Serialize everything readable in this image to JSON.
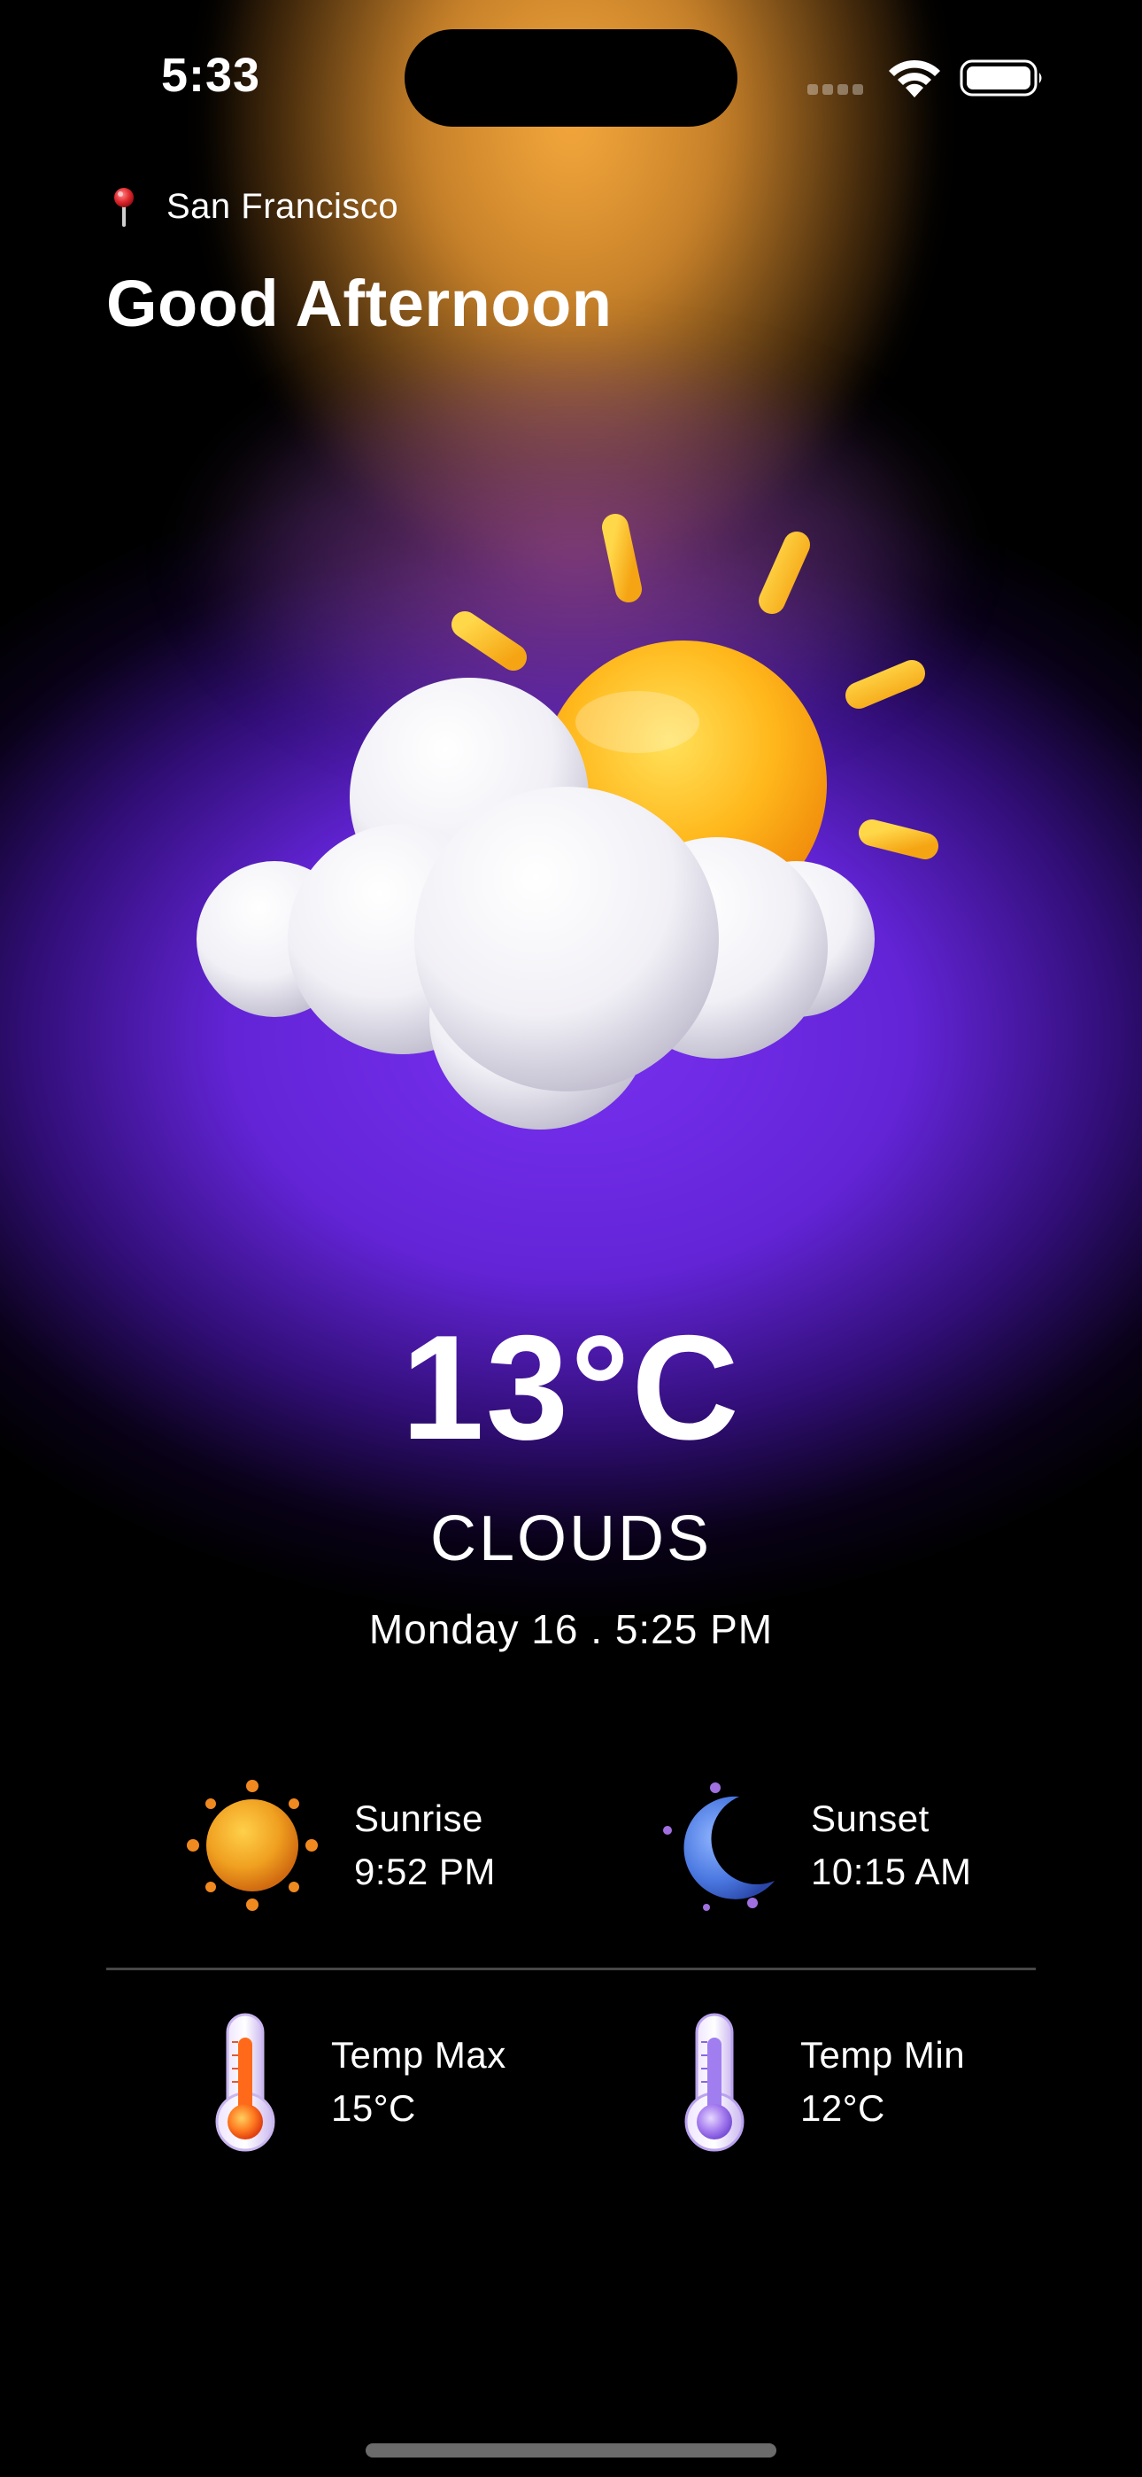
{
  "status_bar": {
    "time": "5:33"
  },
  "header": {
    "location": "San Francisco",
    "greeting": "Good Afternoon"
  },
  "current": {
    "temperature": "13°C",
    "condition": "CLOUDS",
    "datetime": "Monday 16 . 5:25 PM",
    "icon": "sun-behind-clouds-icon"
  },
  "details": {
    "sunrise": {
      "label": "Sunrise",
      "value": "9:52 PM",
      "icon": "sunrise-icon"
    },
    "sunset": {
      "label": "Sunset",
      "value": "10:15 AM",
      "icon": "moon-icon"
    },
    "temp_max": {
      "label": "Temp Max",
      "value": "15°C",
      "icon": "thermometer-hot-icon"
    },
    "temp_min": {
      "label": "Temp Min",
      "value": "12°C",
      "icon": "thermometer-cold-icon"
    }
  },
  "colors": {
    "background": "#000000",
    "orange_glow": "#F5A83C",
    "purple_glow": "#7830F0",
    "text": "#FFFFFF"
  }
}
